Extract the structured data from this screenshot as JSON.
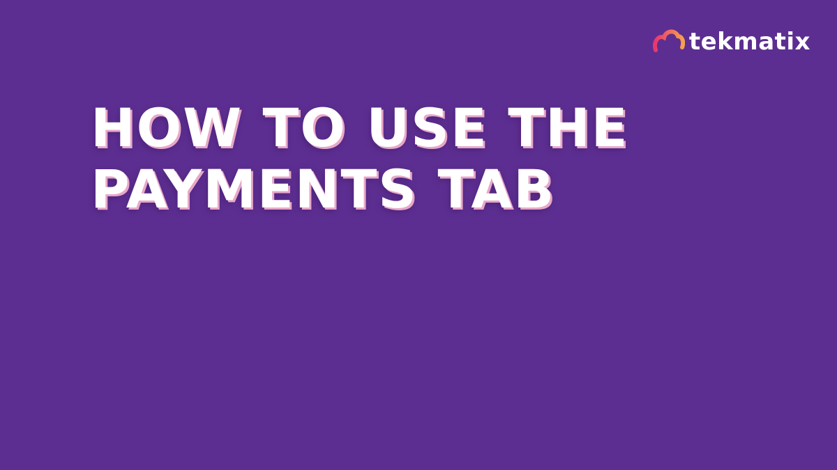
{
  "brand": {
    "name": "tekmatix",
    "logo_icon": "cloud-arc-logo-icon",
    "gradient": [
      "#e8366f",
      "#f5a14b"
    ]
  },
  "headline": {
    "lines": [
      "HOW TO USE THE",
      "PAYMENTS TAB"
    ]
  },
  "colors": {
    "background": "#5c2e91",
    "text": "#ffffff",
    "text_shadow": "#e8a7c8"
  }
}
